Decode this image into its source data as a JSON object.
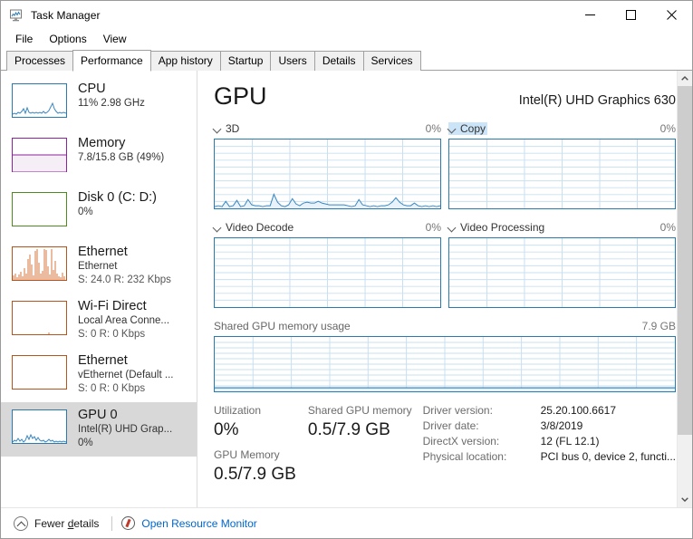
{
  "window": {
    "title": "Task Manager",
    "icon": "task-manager-icon",
    "controls": {
      "minimize": "—",
      "maximize": "☐",
      "close": "✕"
    }
  },
  "menu": {
    "items": [
      "File",
      "Options",
      "View"
    ]
  },
  "tabs": {
    "items": [
      "Processes",
      "Performance",
      "App history",
      "Startup",
      "Users",
      "Details",
      "Services"
    ],
    "active": "Performance"
  },
  "sidebar": {
    "items": [
      {
        "name": "CPU",
        "sub1": "11%  2.98 GHz",
        "sub2": "",
        "color": "#2a7ab0",
        "selected": false,
        "graph": "cpu"
      },
      {
        "name": "Memory",
        "sub1": "7.8/15.8 GB (49%)",
        "sub2": "",
        "color": "#8b239b",
        "selected": false,
        "graph": "memory"
      },
      {
        "name": "Disk 0 (C: D:)",
        "sub1": "0%",
        "sub2": "",
        "color": "#4d8a1f",
        "selected": false,
        "graph": "disk"
      },
      {
        "name": "Ethernet",
        "sub1": "Ethernet",
        "sub2": "S: 24.0 R: 232 Kbps",
        "color": "#b5551d",
        "selected": false,
        "graph": "eth-active"
      },
      {
        "name": "Wi-Fi Direct",
        "sub1": "Local Area Conne...",
        "sub2": "S: 0 R: 0 Kbps",
        "color": "#b5551d",
        "selected": false,
        "graph": "eth-idle"
      },
      {
        "name": "Ethernet",
        "sub1": "vEthernet (Default ...",
        "sub2": "S: 0 R: 0 Kbps",
        "color": "#b5551d",
        "selected": false,
        "graph": "eth-idle"
      },
      {
        "name": "GPU 0",
        "sub1": "Intel(R) UHD Grap...",
        "sub2": "0%",
        "color": "#2a7ab0",
        "selected": true,
        "graph": "gpu"
      }
    ]
  },
  "main": {
    "title": "GPU",
    "device": "Intel(R) UHD Graphics 630",
    "engines": [
      {
        "label": "3D",
        "value": "0%",
        "highlighted": false
      },
      {
        "label": "Copy",
        "value": "0%",
        "highlighted": true
      },
      {
        "label": "Video Decode",
        "value": "0%",
        "highlighted": false
      },
      {
        "label": "Video Processing",
        "value": "0%",
        "highlighted": false
      }
    ],
    "shared_memory_section": {
      "label": "Shared GPU memory usage",
      "max": "7.9 GB"
    },
    "stats": {
      "utilization_label": "Utilization",
      "utilization_value": "0%",
      "gpu_memory_label": "GPU Memory",
      "gpu_memory_value": "0.5/7.9 GB",
      "shared_gpu_memory_label": "Shared GPU memory",
      "shared_gpu_memory_value": "0.5/7.9 GB"
    },
    "info": [
      {
        "key": "Driver version:",
        "value": "25.20.100.6617"
      },
      {
        "key": "Driver date:",
        "value": "3/8/2019"
      },
      {
        "key": "DirectX version:",
        "value": "12 (FL 12.1)"
      },
      {
        "key": "Physical location:",
        "value": "PCI bus 0, device 2, functi..."
      }
    ]
  },
  "footer": {
    "fewer_details": "Fewer details",
    "fewer_details_accel": "d",
    "open_resource_monitor": "Open Resource Monitor"
  },
  "colors": {
    "graph_border": "#2a7ab0",
    "graph_line": "#3a87c0",
    "grid": "#c9e0f0",
    "link": "#0066cc",
    "selected_row": "#d8d8d8",
    "highlight": "#cce4f7"
  },
  "chart_data": [
    {
      "type": "line",
      "title": "3D",
      "ylim": [
        0,
        100
      ],
      "ylabel": "%",
      "grid": true,
      "values": [
        2,
        3,
        2,
        8,
        3,
        2,
        9,
        3,
        2,
        10,
        4,
        3,
        3,
        3,
        3,
        3,
        18,
        6,
        3,
        3,
        4,
        12,
        5,
        3,
        6,
        7,
        6,
        6,
        8,
        6,
        5,
        4,
        4,
        4,
        4,
        4,
        3,
        3,
        3,
        11,
        4,
        3,
        3,
        3,
        3,
        3,
        3,
        4,
        7,
        12,
        7,
        4,
        3,
        3,
        6,
        3,
        3,
        3
      ]
    },
    {
      "type": "line",
      "title": "Copy",
      "ylim": [
        0,
        100
      ],
      "grid": true,
      "values": [
        0,
        0,
        0,
        0,
        0,
        0,
        0,
        0,
        0,
        0,
        0,
        0,
        0,
        0,
        0,
        0,
        0,
        0,
        0,
        0,
        0,
        0,
        0,
        0,
        0,
        0,
        0,
        0,
        0,
        0
      ]
    },
    {
      "type": "line",
      "title": "Video Decode",
      "ylim": [
        0,
        100
      ],
      "grid": true,
      "values": [
        0,
        0,
        0,
        0,
        0,
        0,
        0,
        0,
        0,
        0,
        0,
        0,
        0,
        0,
        0,
        0,
        0,
        0,
        0,
        0,
        0,
        0,
        0,
        0,
        0,
        0,
        0,
        0,
        0,
        0
      ]
    },
    {
      "type": "line",
      "title": "Video Processing",
      "ylim": [
        0,
        100
      ],
      "grid": true,
      "values": [
        0,
        0,
        0,
        0,
        0,
        0,
        0,
        0,
        0,
        0,
        0,
        0,
        0,
        0,
        0,
        0,
        0,
        0,
        0,
        0,
        0,
        0,
        0,
        0,
        0,
        0,
        0,
        0,
        0,
        0
      ]
    },
    {
      "type": "area",
      "title": "Shared GPU memory usage",
      "ylim": [
        0,
        7.9
      ],
      "ylabel": "GB",
      "grid": true,
      "values": [
        0.5,
        0.5,
        0.5,
        0.5,
        0.5,
        0.5,
        0.5,
        0.5,
        0.5,
        0.5,
        0.5,
        0.5,
        0.5,
        0.5,
        0.5,
        0.5,
        0.5,
        0.5,
        0.5,
        0.5,
        0.5,
        0.5,
        0.5,
        0.5,
        0.5,
        0.5,
        0.5,
        0.5,
        0.5,
        0.5
      ]
    }
  ]
}
